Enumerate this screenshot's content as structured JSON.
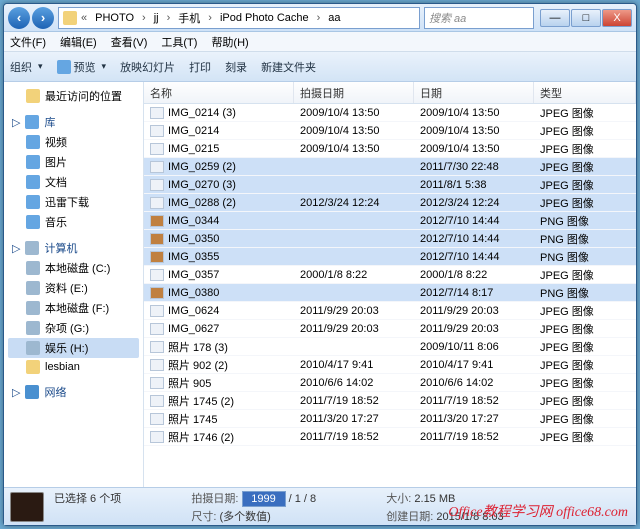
{
  "title_ctrl": {
    "min": "—",
    "max": "□",
    "close": "X"
  },
  "breadcrumb": [
    "PHOTO",
    "jj",
    "手机",
    "iPod Photo Cache",
    "aa"
  ],
  "search": {
    "placeholder": "搜索 aa"
  },
  "menu": {
    "file": "文件(F)",
    "edit": "编辑(E)",
    "view": "查看(V)",
    "tools": "工具(T)",
    "help": "帮助(H)"
  },
  "toolbar": {
    "organize": "组织",
    "preview": "预览",
    "slideshow": "放映幻灯片",
    "print": "打印",
    "burn": "刻录",
    "newfolder": "新建文件夹"
  },
  "sidebar": {
    "recent": "最近访问的位置",
    "libs_hdr": "库",
    "libs": [
      "视频",
      "图片",
      "文档",
      "迅雷下载",
      "音乐"
    ],
    "comp_hdr": "计算机",
    "drives": [
      "本地磁盘 (C:)",
      "资料 (E:)",
      "本地磁盘 (F:)",
      "杂项 (G:)",
      "娱乐 (H:)"
    ],
    "folders": [
      "lesbian"
    ],
    "network": "网络"
  },
  "columns": {
    "name": "名称",
    "shot": "拍摄日期",
    "date": "日期",
    "type": "类型"
  },
  "type_jpeg": "JPEG 图像",
  "type_png": "PNG 图像",
  "files": [
    {
      "n": "IMG_0214 (3)",
      "s": "2009/10/4 13:50",
      "d": "2009/10/4 13:50",
      "t": "jpeg",
      "sel": false
    },
    {
      "n": "IMG_0214",
      "s": "2009/10/4 13:50",
      "d": "2009/10/4 13:50",
      "t": "jpeg",
      "sel": false
    },
    {
      "n": "IMG_0215",
      "s": "2009/10/4 13:50",
      "d": "2009/10/4 13:50",
      "t": "jpeg",
      "sel": false
    },
    {
      "n": "IMG_0259 (2)",
      "s": "",
      "d": "2011/7/30 22:48",
      "t": "jpeg",
      "sel": true
    },
    {
      "n": "IMG_0270 (3)",
      "s": "",
      "d": "2011/8/1 5:38",
      "t": "jpeg",
      "sel": true
    },
    {
      "n": "IMG_0288 (2)",
      "s": "2012/3/24 12:24",
      "d": "2012/3/24 12:24",
      "t": "jpeg",
      "sel": true
    },
    {
      "n": "IMG_0344",
      "s": "",
      "d": "2012/7/10 14:44",
      "t": "png",
      "sel": true
    },
    {
      "n": "IMG_0350",
      "s": "",
      "d": "2012/7/10 14:44",
      "t": "png",
      "sel": true
    },
    {
      "n": "IMG_0355",
      "s": "",
      "d": "2012/7/10 14:44",
      "t": "png",
      "sel": true
    },
    {
      "n": "IMG_0357",
      "s": "2000/1/8 8:22",
      "d": "2000/1/8 8:22",
      "t": "jpeg",
      "sel": false
    },
    {
      "n": "IMG_0380",
      "s": "",
      "d": "2012/7/14 8:17",
      "t": "png",
      "sel": true
    },
    {
      "n": "IMG_0624",
      "s": "2011/9/29 20:03",
      "d": "2011/9/29 20:03",
      "t": "jpeg",
      "sel": false
    },
    {
      "n": "IMG_0627",
      "s": "2011/9/29 20:03",
      "d": "2011/9/29 20:03",
      "t": "jpeg",
      "sel": false
    },
    {
      "n": "照片 178 (3)",
      "s": "",
      "d": "2009/10/11 8:06",
      "t": "jpeg",
      "sel": false
    },
    {
      "n": "照片 902 (2)",
      "s": "2010/4/17 9:41",
      "d": "2010/4/17 9:41",
      "t": "jpeg",
      "sel": false
    },
    {
      "n": "照片 905",
      "s": "2010/6/6 14:02",
      "d": "2010/6/6 14:02",
      "t": "jpeg",
      "sel": false
    },
    {
      "n": "照片 1745 (2)",
      "s": "2011/7/19 18:52",
      "d": "2011/7/19 18:52",
      "t": "jpeg",
      "sel": false
    },
    {
      "n": "照片 1745",
      "s": "2011/3/20 17:27",
      "d": "2011/3/20 17:27",
      "t": "jpeg",
      "sel": false
    },
    {
      "n": "照片 1746 (2)",
      "s": "2011/7/19 18:52",
      "d": "2011/7/19 18:52",
      "t": "jpeg",
      "sel": false
    }
  ],
  "status": {
    "selected": "已选择 6 个项",
    "shot_lbl": "拍摄日期:",
    "shot_val_edit": "1999",
    "shot_val_rest": "/ 1 / 8",
    "size_lbl": "大小:",
    "size_val": "2.15 MB",
    "dim_lbl": "尺寸:",
    "dim_val": "(多个数值)",
    "created_lbl": "创建日期:",
    "created_val": "2015/1/8 8:03"
  },
  "watermark": "Office教程学习网\noffice68.com"
}
